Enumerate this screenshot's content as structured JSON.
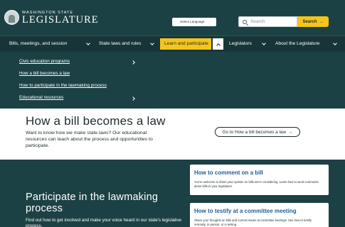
{
  "header": {
    "logo_top": "WASHINGTON STATE",
    "logo_main": "LEGISLATURE",
    "language_select": "Select Language",
    "search_placeholder": "Search",
    "search_button": "Search",
    "search_button_arrow": "→"
  },
  "nav": {
    "items": [
      {
        "label": "Bills, meetings, and session"
      },
      {
        "label": "State laws and rules"
      },
      {
        "label": "Learn and participate",
        "active": true
      },
      {
        "label": "Legislators"
      },
      {
        "label": "About the Legislature"
      }
    ]
  },
  "dropdown": {
    "items": [
      {
        "label": "Civic education programs",
        "has_submenu": true
      },
      {
        "label": "How a bill becomes a law",
        "has_submenu": false
      },
      {
        "label": "How to participate in the lawmaking process",
        "has_submenu": false
      },
      {
        "label": "Educational resources",
        "has_submenu": true
      }
    ]
  },
  "hero": {
    "title": "How a bill becomes a law",
    "description": "Want to know how we make state laws? Our educational resources can teach about the process and opportunities to participate.",
    "button": "Go to How a bill becomes a law",
    "button_arrow": "→"
  },
  "participate": {
    "title": "Participate in the lawmaking process",
    "description": "Find out how to get involved and make your voice heard in our state's legislative process.",
    "cards": [
      {
        "title": "How to comment on a bill",
        "text": "You're welcome to share your opinion on bills we're considering. Learn how to send comments about bills to your legislators."
      },
      {
        "title": "How to testify at a committee meeting",
        "text": "Share your thoughts on bills and current issues at committee hearings. See how to testify remotely, in person, or in writing."
      }
    ]
  },
  "colors": {
    "header_bg": "#1c4144",
    "accent_yellow": "#f4c51a",
    "link_blue": "#1f5f96"
  }
}
